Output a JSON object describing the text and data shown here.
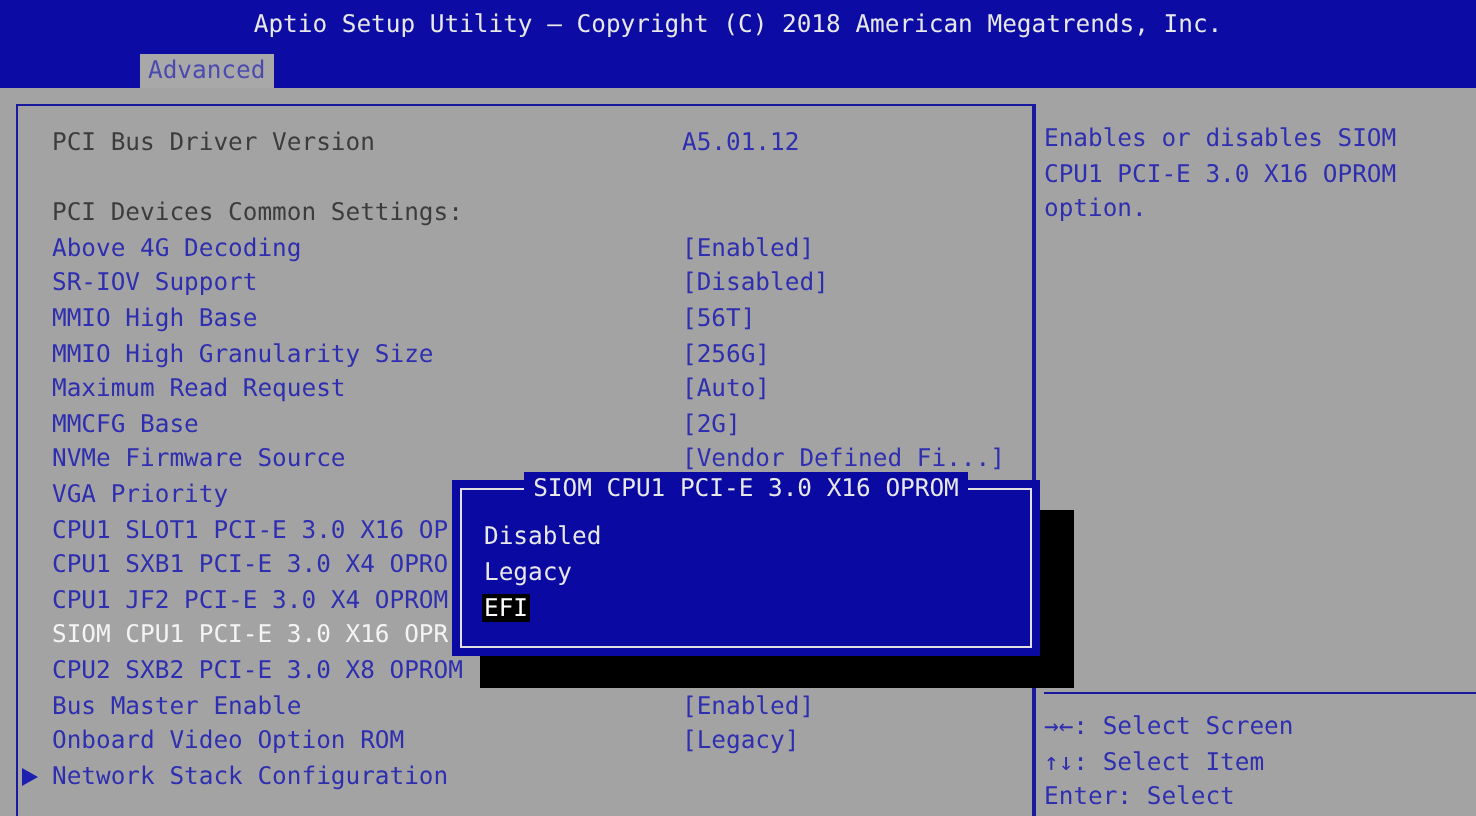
{
  "header": {
    "title": "Aptio Setup Utility – Copyright (C) 2018 American Megatrends, Inc."
  },
  "tabs": [
    {
      "label": "Advanced",
      "selected": true
    }
  ],
  "settings": [
    {
      "kind": "info",
      "label": "PCI Bus Driver Version",
      "value": "A5.01.12",
      "selected": false
    },
    {
      "kind": "blank"
    },
    {
      "kind": "info",
      "label": "PCI Devices Common Settings:",
      "selected": false
    },
    {
      "kind": "setting",
      "label": "Above 4G Decoding",
      "value": "[Enabled]",
      "selected": false
    },
    {
      "kind": "setting",
      "label": "SR-IOV Support",
      "value": "[Disabled]",
      "selected": false
    },
    {
      "kind": "setting",
      "label": "MMIO High Base",
      "value": "[56T]",
      "selected": false
    },
    {
      "kind": "setting",
      "label": "MMIO High Granularity Size",
      "value": "[256G]",
      "selected": false
    },
    {
      "kind": "setting",
      "label": "Maximum Read Request",
      "value": "[Auto]",
      "selected": false
    },
    {
      "kind": "setting",
      "label": "MMCFG Base",
      "value": "[2G]",
      "selected": false
    },
    {
      "kind": "setting",
      "label": "NVMe Firmware Source",
      "value": "[Vendor Defined Fi...]",
      "selected": false
    },
    {
      "kind": "setting",
      "label": "VGA Priority",
      "selected": false
    },
    {
      "kind": "setting",
      "label": "CPU1 SLOT1 PCI-E 3.0 X16 OP",
      "selected": false
    },
    {
      "kind": "setting",
      "label": "CPU1 SXB1 PCI-E 3.0 X4 OPRO",
      "selected": false
    },
    {
      "kind": "setting",
      "label": "CPU1 JF2 PCI-E 3.0 X4 OPROM",
      "selected": false
    },
    {
      "kind": "setting",
      "label": "SIOM CPU1 PCI-E 3.0 X16 OPR",
      "selected": true
    },
    {
      "kind": "setting",
      "label": "CPU2 SXB2 PCI-E 3.0 X8 OPROM",
      "selected": false
    },
    {
      "kind": "setting",
      "label": "Bus Master Enable",
      "value": "[Enabled]",
      "selected": false
    },
    {
      "kind": "setting",
      "label": "Onboard Video Option ROM",
      "value": "[Legacy]",
      "selected": false
    },
    {
      "kind": "submenu",
      "label": "Network Stack Configuration",
      "selected": false
    }
  ],
  "help": {
    "description": "Enables or disables SIOM CPU1 PCI-E 3.0 X16 OPROM option.",
    "keys": [
      "→←: Select Screen",
      "↑↓: Select Item",
      "Enter: Select"
    ]
  },
  "popup": {
    "title": "SIOM CPU1 PCI-E 3.0 X16 OPROM",
    "options": [
      {
        "label": "Disabled",
        "selected": false
      },
      {
        "label": "Legacy",
        "selected": false
      },
      {
        "label": "EFI",
        "selected": true
      }
    ]
  }
}
